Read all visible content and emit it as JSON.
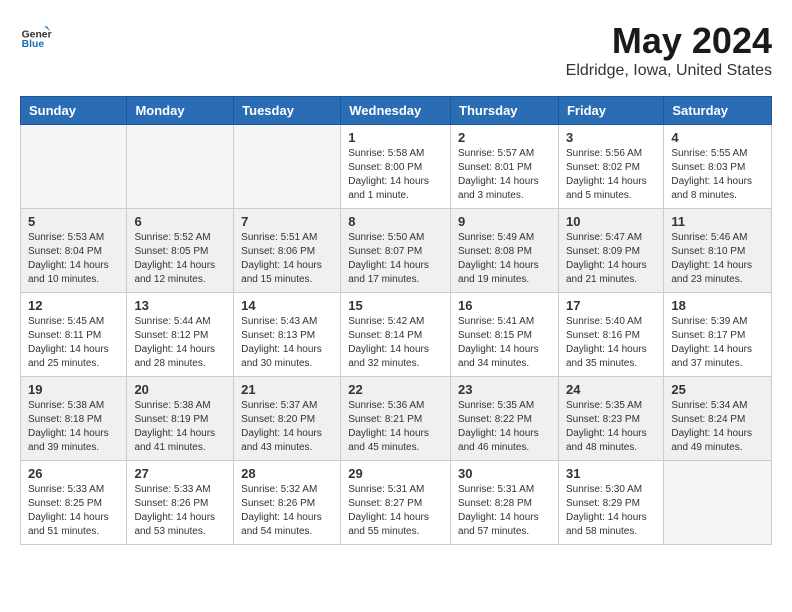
{
  "header": {
    "logo_general": "General",
    "logo_blue": "Blue",
    "title": "May 2024",
    "location": "Eldridge, Iowa, United States"
  },
  "days_of_week": [
    "Sunday",
    "Monday",
    "Tuesday",
    "Wednesday",
    "Thursday",
    "Friday",
    "Saturday"
  ],
  "weeks": [
    [
      {
        "day": "",
        "info": ""
      },
      {
        "day": "",
        "info": ""
      },
      {
        "day": "",
        "info": ""
      },
      {
        "day": "1",
        "info": "Sunrise: 5:58 AM\nSunset: 8:00 PM\nDaylight: 14 hours\nand 1 minute."
      },
      {
        "day": "2",
        "info": "Sunrise: 5:57 AM\nSunset: 8:01 PM\nDaylight: 14 hours\nand 3 minutes."
      },
      {
        "day": "3",
        "info": "Sunrise: 5:56 AM\nSunset: 8:02 PM\nDaylight: 14 hours\nand 5 minutes."
      },
      {
        "day": "4",
        "info": "Sunrise: 5:55 AM\nSunset: 8:03 PM\nDaylight: 14 hours\nand 8 minutes."
      }
    ],
    [
      {
        "day": "5",
        "info": "Sunrise: 5:53 AM\nSunset: 8:04 PM\nDaylight: 14 hours\nand 10 minutes."
      },
      {
        "day": "6",
        "info": "Sunrise: 5:52 AM\nSunset: 8:05 PM\nDaylight: 14 hours\nand 12 minutes."
      },
      {
        "day": "7",
        "info": "Sunrise: 5:51 AM\nSunset: 8:06 PM\nDaylight: 14 hours\nand 15 minutes."
      },
      {
        "day": "8",
        "info": "Sunrise: 5:50 AM\nSunset: 8:07 PM\nDaylight: 14 hours\nand 17 minutes."
      },
      {
        "day": "9",
        "info": "Sunrise: 5:49 AM\nSunset: 8:08 PM\nDaylight: 14 hours\nand 19 minutes."
      },
      {
        "day": "10",
        "info": "Sunrise: 5:47 AM\nSunset: 8:09 PM\nDaylight: 14 hours\nand 21 minutes."
      },
      {
        "day": "11",
        "info": "Sunrise: 5:46 AM\nSunset: 8:10 PM\nDaylight: 14 hours\nand 23 minutes."
      }
    ],
    [
      {
        "day": "12",
        "info": "Sunrise: 5:45 AM\nSunset: 8:11 PM\nDaylight: 14 hours\nand 25 minutes."
      },
      {
        "day": "13",
        "info": "Sunrise: 5:44 AM\nSunset: 8:12 PM\nDaylight: 14 hours\nand 28 minutes."
      },
      {
        "day": "14",
        "info": "Sunrise: 5:43 AM\nSunset: 8:13 PM\nDaylight: 14 hours\nand 30 minutes."
      },
      {
        "day": "15",
        "info": "Sunrise: 5:42 AM\nSunset: 8:14 PM\nDaylight: 14 hours\nand 32 minutes."
      },
      {
        "day": "16",
        "info": "Sunrise: 5:41 AM\nSunset: 8:15 PM\nDaylight: 14 hours\nand 34 minutes."
      },
      {
        "day": "17",
        "info": "Sunrise: 5:40 AM\nSunset: 8:16 PM\nDaylight: 14 hours\nand 35 minutes."
      },
      {
        "day": "18",
        "info": "Sunrise: 5:39 AM\nSunset: 8:17 PM\nDaylight: 14 hours\nand 37 minutes."
      }
    ],
    [
      {
        "day": "19",
        "info": "Sunrise: 5:38 AM\nSunset: 8:18 PM\nDaylight: 14 hours\nand 39 minutes."
      },
      {
        "day": "20",
        "info": "Sunrise: 5:38 AM\nSunset: 8:19 PM\nDaylight: 14 hours\nand 41 minutes."
      },
      {
        "day": "21",
        "info": "Sunrise: 5:37 AM\nSunset: 8:20 PM\nDaylight: 14 hours\nand 43 minutes."
      },
      {
        "day": "22",
        "info": "Sunrise: 5:36 AM\nSunset: 8:21 PM\nDaylight: 14 hours\nand 45 minutes."
      },
      {
        "day": "23",
        "info": "Sunrise: 5:35 AM\nSunset: 8:22 PM\nDaylight: 14 hours\nand 46 minutes."
      },
      {
        "day": "24",
        "info": "Sunrise: 5:35 AM\nSunset: 8:23 PM\nDaylight: 14 hours\nand 48 minutes."
      },
      {
        "day": "25",
        "info": "Sunrise: 5:34 AM\nSunset: 8:24 PM\nDaylight: 14 hours\nand 49 minutes."
      }
    ],
    [
      {
        "day": "26",
        "info": "Sunrise: 5:33 AM\nSunset: 8:25 PM\nDaylight: 14 hours\nand 51 minutes."
      },
      {
        "day": "27",
        "info": "Sunrise: 5:33 AM\nSunset: 8:26 PM\nDaylight: 14 hours\nand 53 minutes."
      },
      {
        "day": "28",
        "info": "Sunrise: 5:32 AM\nSunset: 8:26 PM\nDaylight: 14 hours\nand 54 minutes."
      },
      {
        "day": "29",
        "info": "Sunrise: 5:31 AM\nSunset: 8:27 PM\nDaylight: 14 hours\nand 55 minutes."
      },
      {
        "day": "30",
        "info": "Sunrise: 5:31 AM\nSunset: 8:28 PM\nDaylight: 14 hours\nand 57 minutes."
      },
      {
        "day": "31",
        "info": "Sunrise: 5:30 AM\nSunset: 8:29 PM\nDaylight: 14 hours\nand 58 minutes."
      },
      {
        "day": "",
        "info": ""
      }
    ]
  ]
}
